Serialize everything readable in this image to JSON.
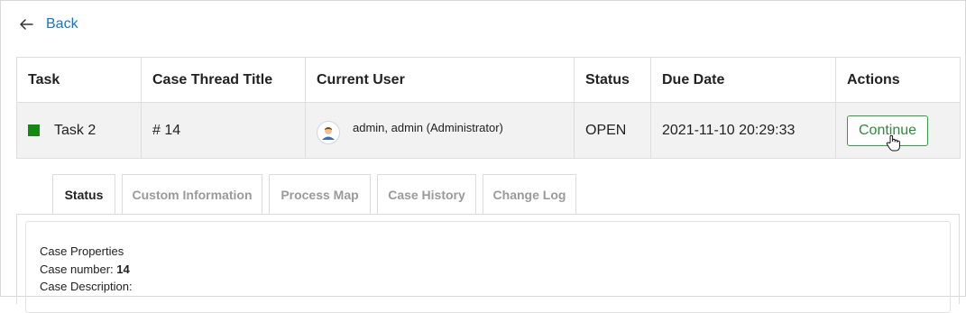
{
  "back": {
    "label": "Back",
    "icon": "arrow-left-icon"
  },
  "table": {
    "headers": [
      "Task",
      "Case Thread Title",
      "Current User",
      "Status",
      "Due Date",
      "Actions"
    ],
    "row": {
      "task": "Task 2",
      "task_status_color": "#128a12",
      "thread_title": "# 14",
      "user": "admin, admin (Administrator)",
      "status": "OPEN",
      "due_date": "2021-11-10 20:29:33",
      "action_label": "Continue"
    }
  },
  "tabs": [
    "Status",
    "Custom Information",
    "Process Map",
    "Case History",
    "Change Log"
  ],
  "active_tab": "Status",
  "case": {
    "heading": "Case Properties",
    "number_label": "Case number:",
    "number_value": "14",
    "description_label": "Case Description:"
  },
  "colors": {
    "link": "#1a73c8",
    "continue": "#2e8b3a"
  }
}
